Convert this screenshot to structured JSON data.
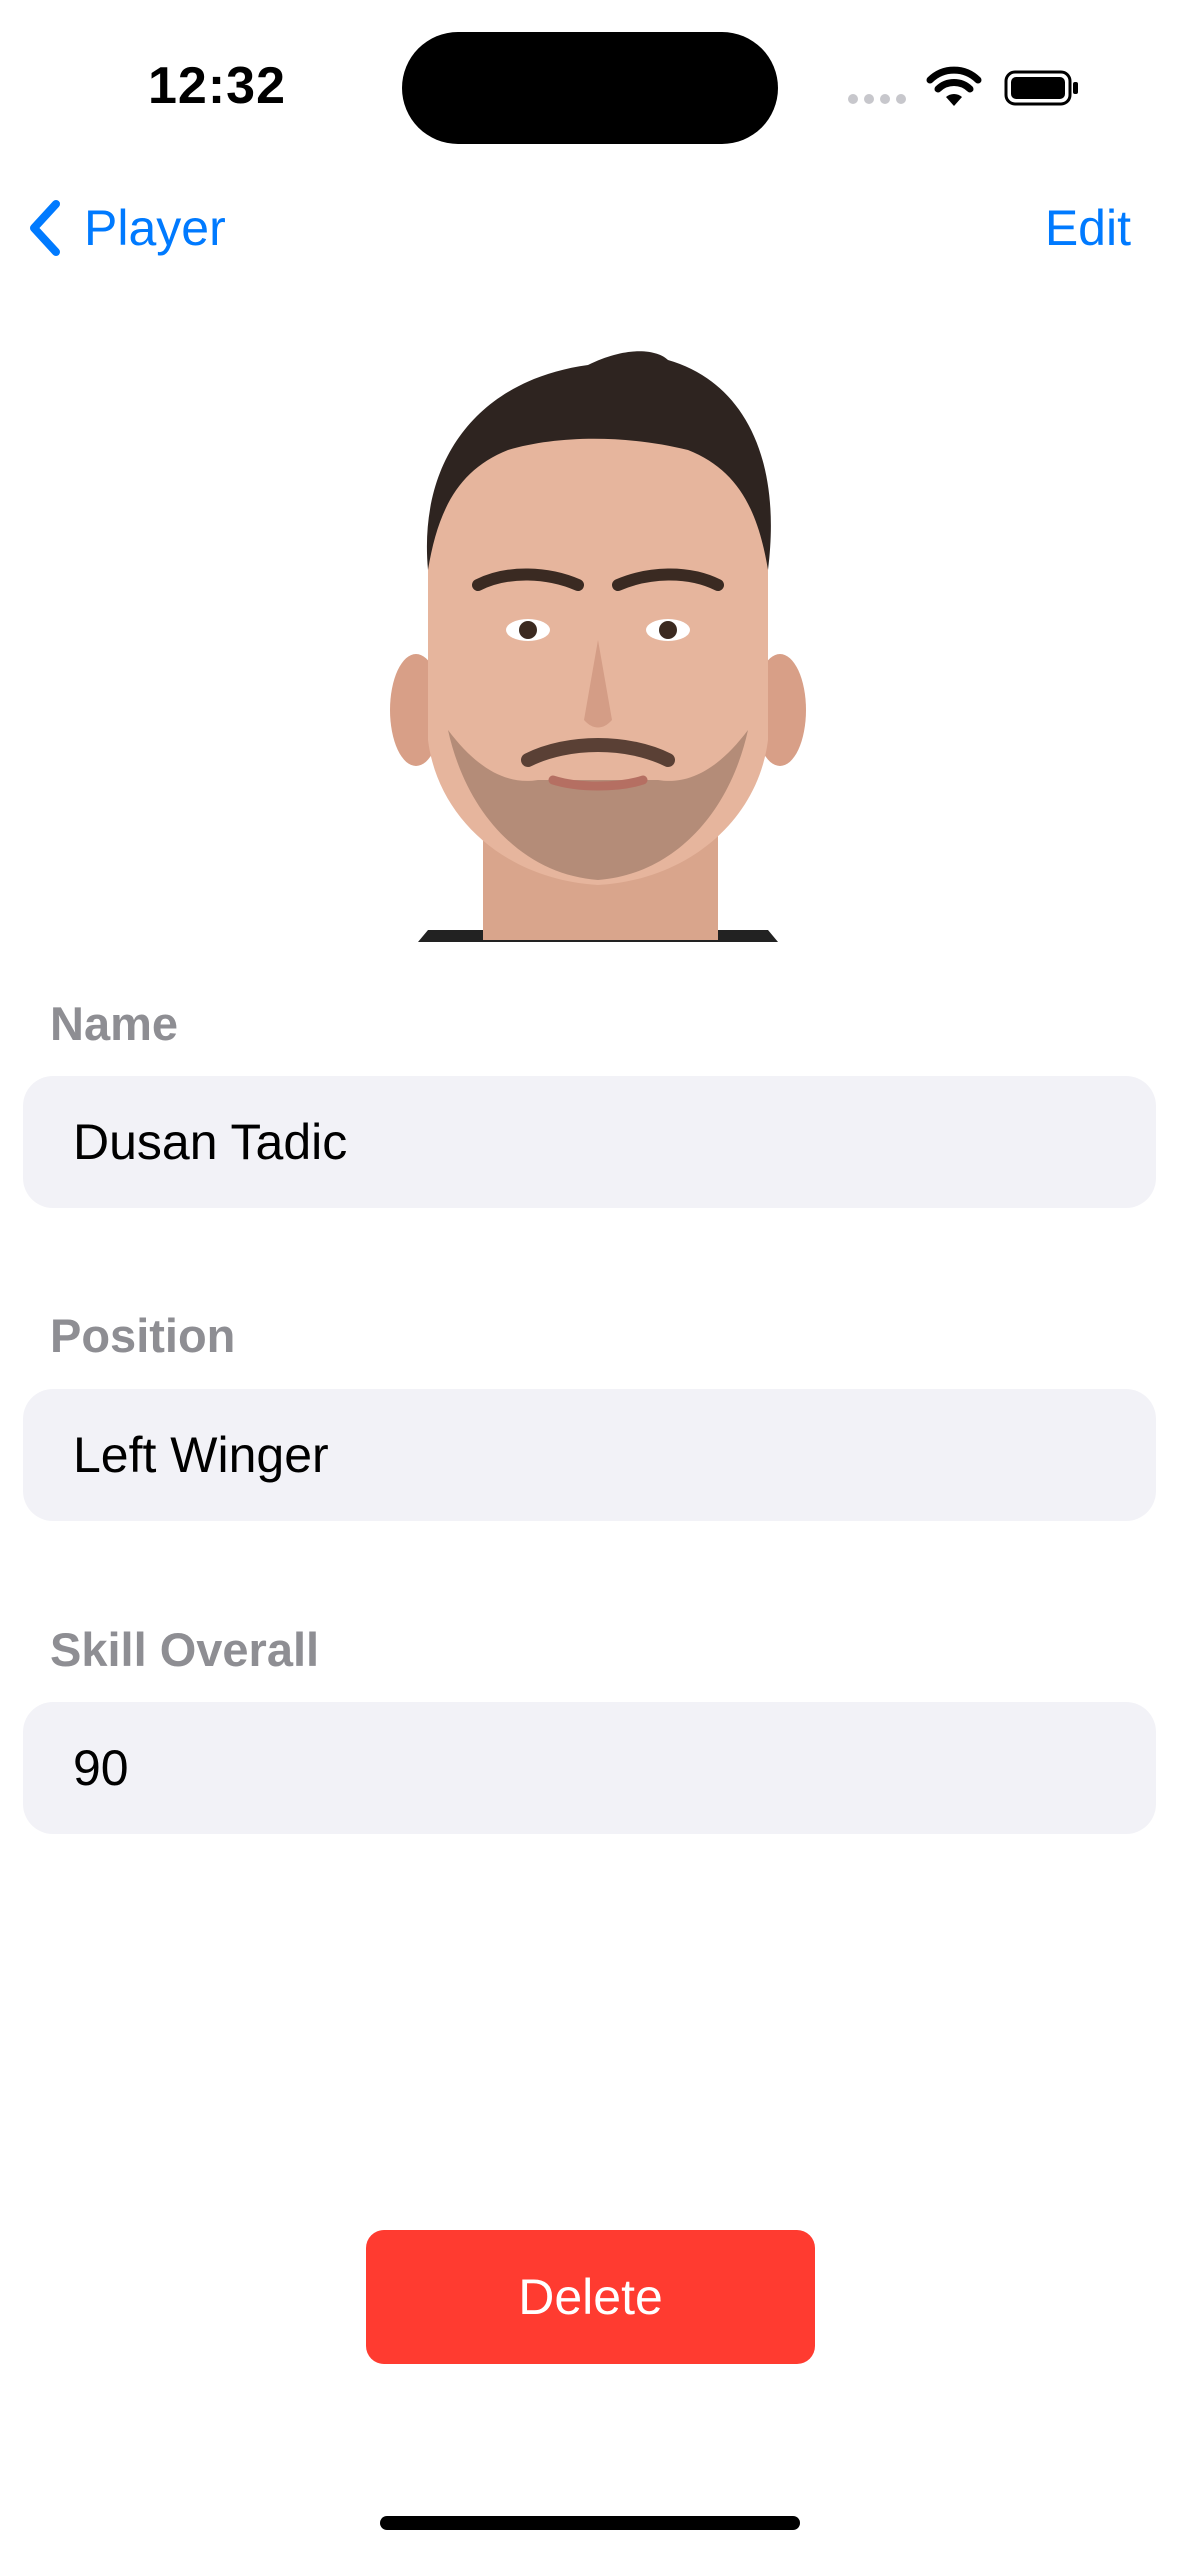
{
  "status_bar": {
    "time": "12:32",
    "signal_icon": "cellular-signal-icon",
    "wifi_icon": "wifi-icon",
    "battery_icon": "battery-icon"
  },
  "nav": {
    "back_label": "Player",
    "back_icon": "chevron-left-icon",
    "edit_label": "Edit",
    "accent_color": "#007aff"
  },
  "player_photo": "player-photo",
  "form": {
    "name_label": "Name",
    "name_value": "Dusan Tadic",
    "position_label": "Position",
    "position_value": "Left Winger",
    "skill_label": "Skill Overall",
    "skill_value": "90"
  },
  "delete_button": {
    "label": "Delete",
    "color": "#ff3b30"
  }
}
